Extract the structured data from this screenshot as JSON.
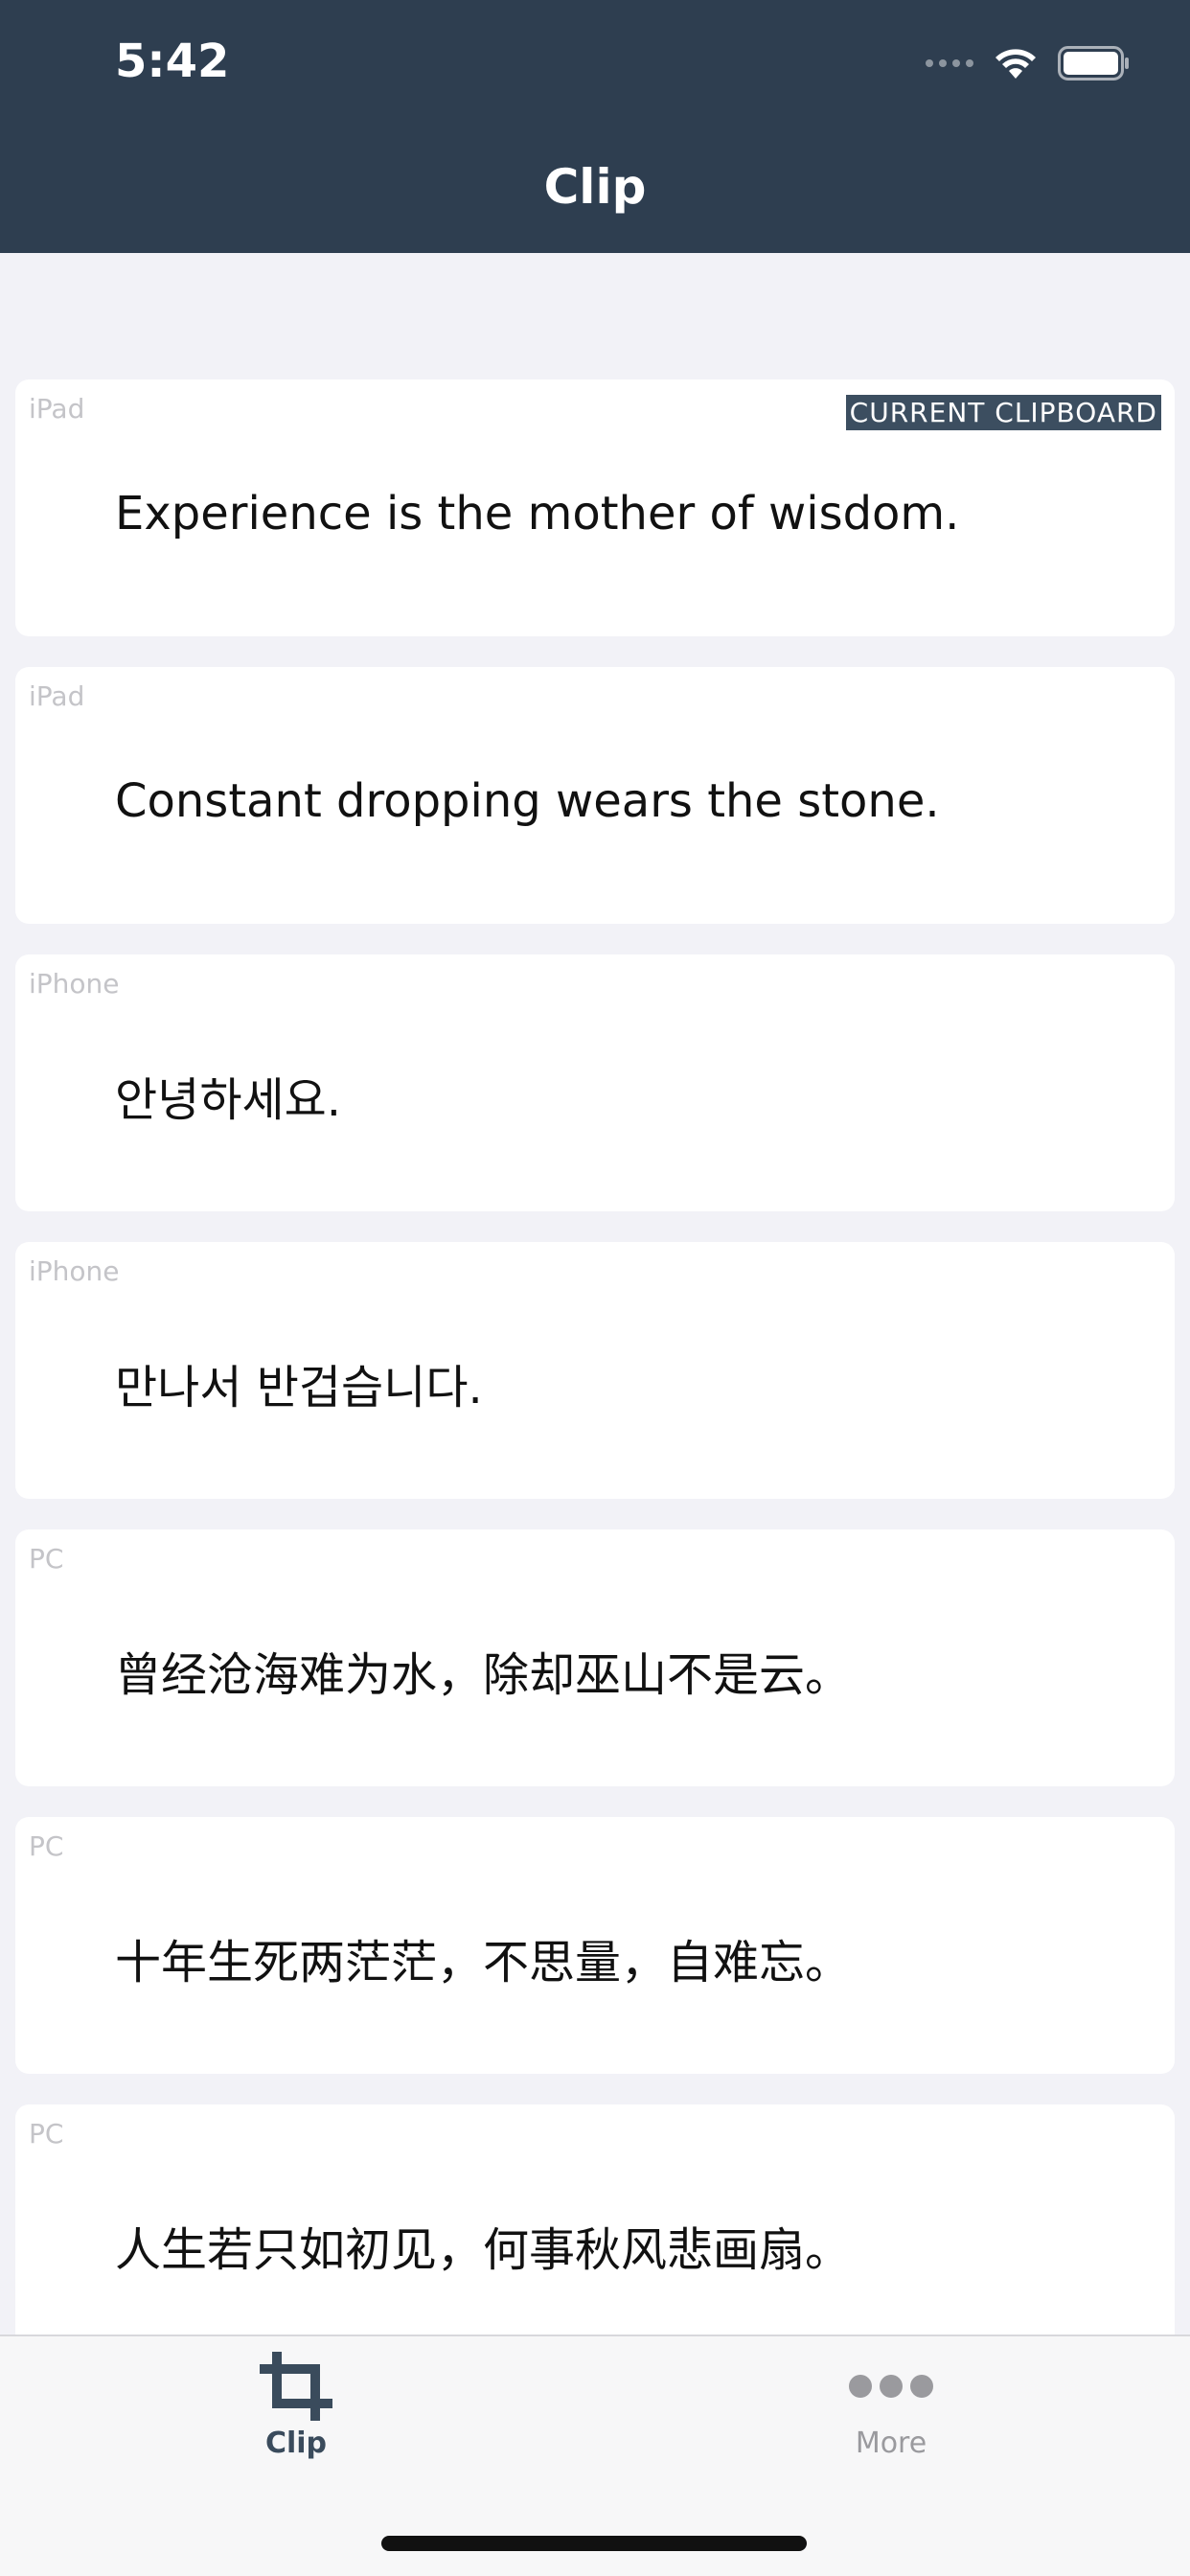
{
  "status_bar": {
    "time": "5:42"
  },
  "nav": {
    "title": "Clip"
  },
  "current_badge": "CURRENT CLIPBOARD",
  "clips": [
    {
      "device": "iPad",
      "text": "Experience is the mother of wisdom.",
      "current": true
    },
    {
      "device": "iPad",
      "text": "Constant dropping wears the stone."
    },
    {
      "device": "iPhone",
      "text": "안녕하세요."
    },
    {
      "device": "iPhone",
      "text": "만나서 반겁습니다."
    },
    {
      "device": "PC",
      "text": "曾经沧海难为水，除却巫山不是云。"
    },
    {
      "device": "PC",
      "text": "十年生死两茫茫，不思量，自难忘。"
    },
    {
      "device": "PC",
      "text": "人生若只如初见，何事秋风悲画扇。"
    }
  ],
  "tabs": [
    {
      "label": "Clip",
      "icon": "crop-icon",
      "active": true
    },
    {
      "label": "More",
      "icon": "more-icon"
    }
  ],
  "colors": {
    "header_bg": "#2e3e50",
    "page_bg": "#f2f2f7",
    "badge_bg": "#3c4e60",
    "tab_active": "#3a4b5c",
    "tab_inactive": "#9a9a9e"
  }
}
